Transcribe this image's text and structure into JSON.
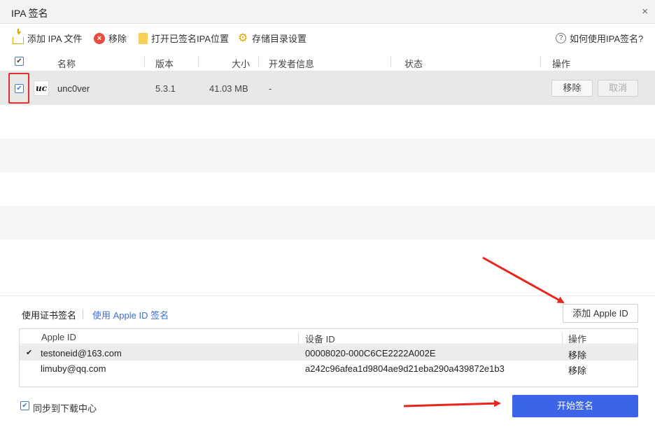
{
  "window": {
    "title": "IPA 签名",
    "close_glyph": "×"
  },
  "toolbar": {
    "add_ipa": "添加 IPA 文件",
    "remove": "移除",
    "open_signed": "打开已签名IPA位置",
    "storage_settings": "存储目录设置",
    "help": "如何使用IPA签名?"
  },
  "table": {
    "headers": {
      "name": "名称",
      "version": "版本",
      "size": "大小",
      "developer": "开发者信息",
      "status": "状态",
      "action": "操作"
    },
    "rows": [
      {
        "icon_text": "uc",
        "name": "unc0ver",
        "version": "5.3.1",
        "size": "41.03 MB",
        "developer": "-",
        "status": "",
        "remove_label": "移除",
        "cancel_label": "取消",
        "checked": true
      }
    ]
  },
  "signing": {
    "tab_cert": "使用证书签名",
    "tab_appleid": "使用 Apple ID 签名",
    "add_appleid": "添加 Apple ID",
    "id_table": {
      "headers": {
        "apple_id": "Apple ID",
        "device_id": "设备 ID",
        "action": "操作"
      },
      "rows": [
        {
          "selected": true,
          "apple_id": "testoneid@163.com",
          "device_id": "00008020-000C6CE2222A002E",
          "action": "移除"
        },
        {
          "selected": false,
          "apple_id": "limuby@qq.com",
          "device_id": "a242c96afea1d9804ae9d21eba290a439872e1b3",
          "action": "移除"
        }
      ]
    },
    "sync_label": "同步到下载中心",
    "sync_checked": true,
    "start_button": "开始签名"
  },
  "colors": {
    "accent": "#3c64e6",
    "highlight": "#e03030",
    "link": "#3a6fd8"
  },
  "icons": {
    "add": "folder-add-icon",
    "remove": "remove-circle-icon",
    "folder": "folder-icon",
    "gear": "gear-icon",
    "help": "help-circle-icon"
  }
}
